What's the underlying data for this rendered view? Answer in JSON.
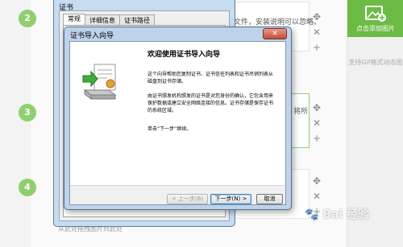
{
  "editor": {
    "steps": [
      {
        "number": "2",
        "text": "文件，安装说明可以忽略。"
      },
      {
        "number": "3",
        "text": "将所"
      },
      {
        "number": "4",
        "text": ""
      }
    ],
    "bottom_hint": "从此处拖拽图片到此处",
    "right_panel": {
      "add_image_label": "点击添加图片",
      "gif_hint": "支持Gif格式动态图"
    },
    "watermark": "Bai 经验"
  },
  "cert_window": {
    "title": "证书",
    "tabs": [
      "常规",
      "详细信息",
      "证书路径"
    ]
  },
  "wizard": {
    "title": "证书导入向导",
    "close": "✕",
    "heading": "欢迎使用证书导入向导",
    "para1": "这个向导帮助您复制证书、证书信任列表和证书吊销列表从磁盘到证书存储。",
    "para2": "由证书颁发机构颁发的证书是对您身份的确认，它包含用来保护数据或建立安全网络连接的信息。证书存储是保存证书的系统区域。",
    "para3": "单击“下一步”继续。",
    "buttons": {
      "back": "< 上一步(B)",
      "next": "下一步(N) >",
      "cancel": "取消"
    }
  },
  "colors": {
    "accent_green": "#6dbb45",
    "step_green": "#8fcf6f",
    "wizard_frame": "#bed3ea",
    "close_red": "#c44d3a"
  }
}
